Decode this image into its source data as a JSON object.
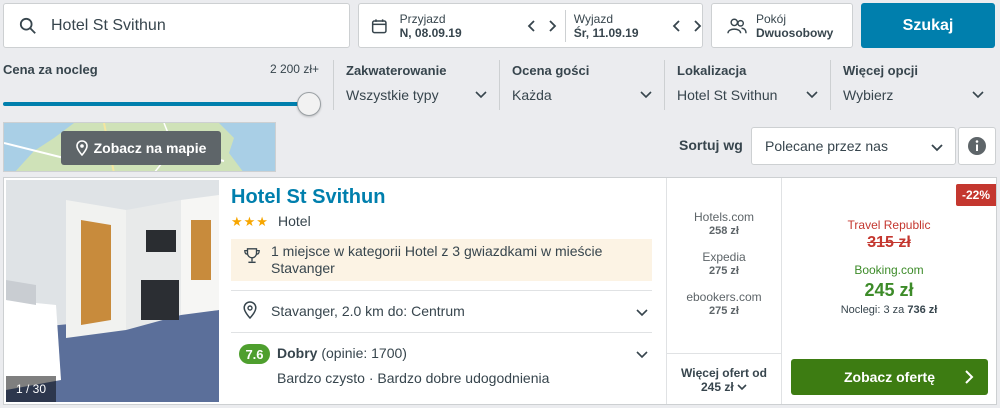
{
  "search": {
    "value": "Hotel St Svithun"
  },
  "dates": {
    "checkin_label": "Przyjazd",
    "checkin_value": "N, 08.09.19",
    "checkout_label": "Wyjazd",
    "checkout_value": "Śr, 11.09.19"
  },
  "room": {
    "label": "Pokój",
    "value": "Dwuosobowy"
  },
  "search_button": "Szukaj",
  "filters": {
    "price": {
      "title": "Cena za nocleg",
      "max": "2 200 zł+",
      "slider_level": 1.0
    },
    "accommodation": {
      "title": "Zakwaterowanie",
      "value": "Wszystkie typy"
    },
    "rating": {
      "title": "Ocena gości",
      "value": "Każda"
    },
    "location": {
      "title": "Lokalizacja",
      "value": "Hotel St Svithun"
    },
    "more": {
      "title": "Więcej opcji",
      "value": "Wybierz"
    }
  },
  "map": {
    "button_label": "Zobacz na mapie"
  },
  "sort": {
    "label": "Sortuj wg",
    "value": "Polecane przez nas"
  },
  "hotel": {
    "name": "Hotel St Svithun",
    "stars": "★★★",
    "star_count": 3,
    "type": "Hotel",
    "photo_count": "1 / 30",
    "award_line1": "1 miejsce w kategorii Hotel z 3 gwiazdkami w mieście",
    "award_line2": "Stavanger",
    "location": "Stavanger, 2.0 km do: Centrum",
    "score": "7.6",
    "score_label": "Dobry",
    "score_count": "(opinie: 1700)",
    "review_summary": "Bardzo czysto · Bardzo dobre udogodnienia"
  },
  "offers": [
    {
      "provider": "Hotels.com",
      "price": "258 zł"
    },
    {
      "provider": "Expedia",
      "price": "275 zł"
    },
    {
      "provider": "ebookers.com",
      "price": "275 zł"
    }
  ],
  "more_offers": {
    "line1": "Więcej ofert od",
    "line2": "245 zł"
  },
  "best_deal": {
    "discount": "-22%",
    "orig_provider": "Travel Republic",
    "orig_price": "315 zł",
    "provider": "Booking.com",
    "price": "245 zł",
    "nights_prefix": "Noclegi: 3 za",
    "nights_total": "736 zł",
    "button_label": "Zobacz ofertę"
  },
  "colors": {
    "accent": "#007fad",
    "deal_green": "#3d7c12",
    "discount_red": "#c4372f",
    "score_green": "#4e9f2e"
  }
}
